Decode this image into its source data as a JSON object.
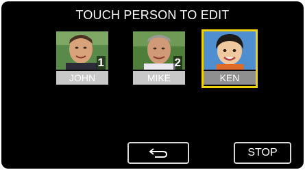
{
  "screen": {
    "title": "TOUCH PERSON TO EDIT"
  },
  "persons": [
    {
      "name": "JOHN",
      "number": "1",
      "selected": false
    },
    {
      "name": "MIKE",
      "number": "2",
      "selected": false
    },
    {
      "name": "KEN",
      "number": "",
      "selected": true
    }
  ],
  "buttons": {
    "back_icon": "return-arrow-icon",
    "stop_label": "STOP"
  },
  "colors": {
    "selection": "#f2d20b",
    "background": "#000000"
  }
}
